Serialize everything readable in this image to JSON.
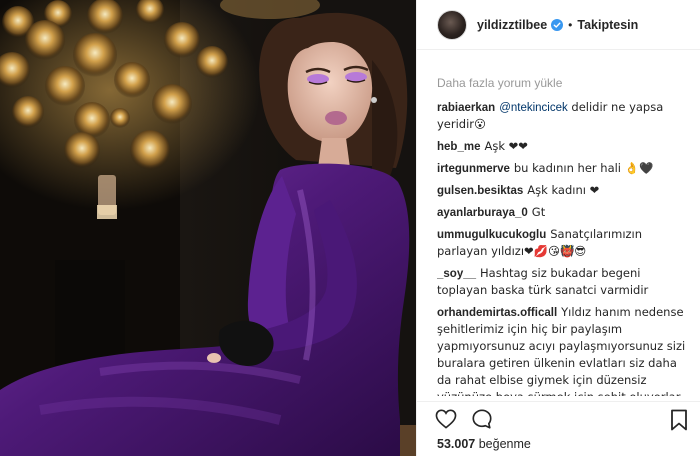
{
  "account": {
    "username": "yildizztilbee",
    "verified": true,
    "separator": "•",
    "follow_state": "Takiptesin"
  },
  "comments_panel": {
    "load_more": "Daha fazla yorum yükle",
    "comments": [
      {
        "author": "rabiaerkan",
        "mention": "@ntekincicek",
        "text": " delidir ne yapsa yeridir😮"
      },
      {
        "author": "heb_me",
        "mention": "",
        "text": "Aşk ❤❤"
      },
      {
        "author": "irtegunmerve",
        "mention": "",
        "text": "bu kadının her hali 👌🖤"
      },
      {
        "author": "gulsen.besiktas",
        "mention": "",
        "text": "Aşk kadını ❤"
      },
      {
        "author": "ayanlarburaya_0",
        "mention": "",
        "text": "Gt"
      },
      {
        "author": "ummugulkucukoglu",
        "mention": "",
        "text": "Sanatçılarımızın parlayan yıldızı❤💋😘👹😎"
      },
      {
        "author": "_soy__",
        "mention": "",
        "text": "Hashtag siz bukadar begeni toplayan baska türk sanatci varmidir"
      },
      {
        "author": "orhandemirtas.officall",
        "mention": "",
        "text": "Yıldız hanım nedense şehitlerimiz için hiç bir paylaşım yapmıyorsunuz acıyı paylaşmıyorsunuz sizi buralara getiren ülkenin evlatları siz daha da rahat elbise giymek için düzensiz yüzünüze boya sürmek için şehit oluyorlar birer olarak yaşam anne yüreklerine maçal"
      }
    ]
  },
  "actions": {
    "like_icon": "heart-icon",
    "comment_icon": "comment-icon",
    "save_icon": "bookmark-icon"
  },
  "likes": {
    "count": "53.007",
    "label": "beğenme"
  },
  "photo": {
    "description_icon": "post-photo",
    "dress_color": "#5a1d86"
  }
}
